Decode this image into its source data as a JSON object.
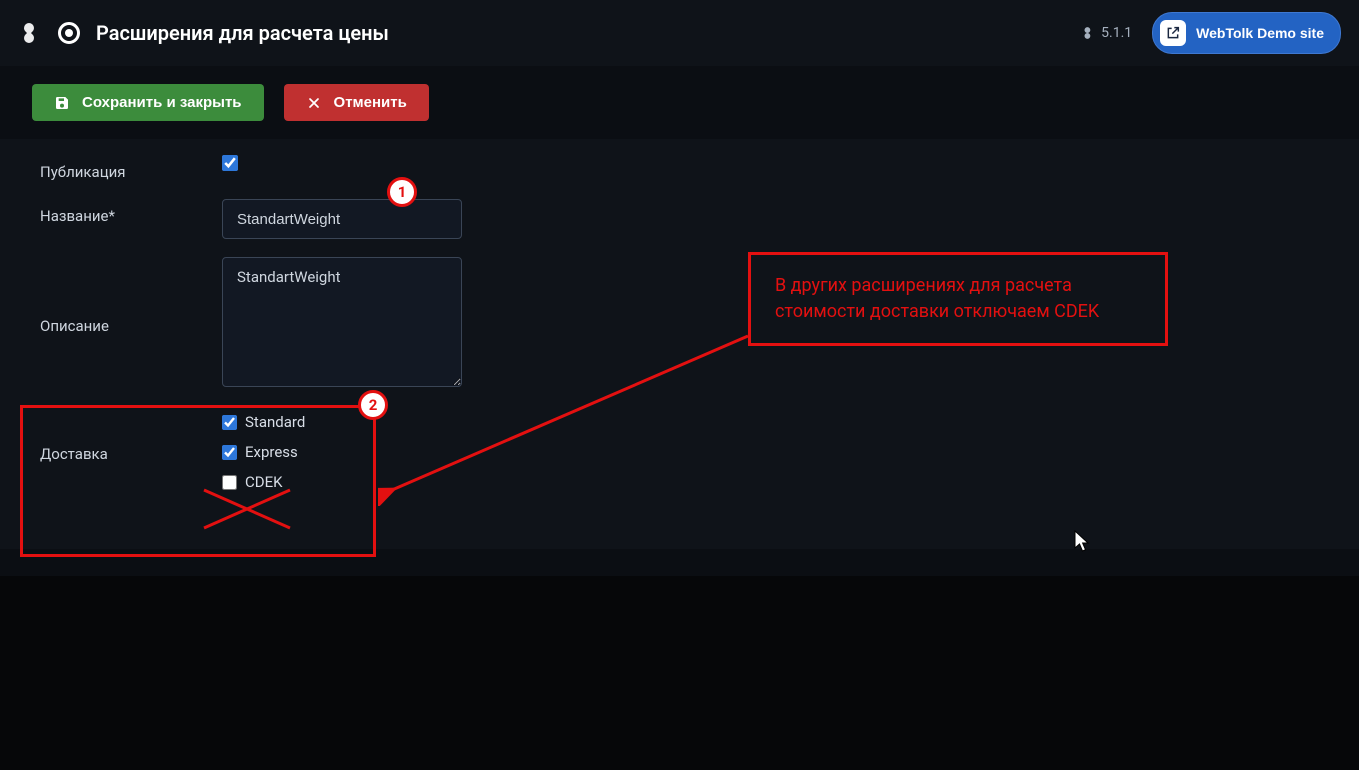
{
  "header": {
    "title": "Расширения для расчета цены",
    "version_label": "5.1.1",
    "demo_label": "WebTolk Demo site"
  },
  "toolbar": {
    "save_label": "Сохранить и закрыть",
    "cancel_label": "Отменить"
  },
  "form": {
    "publish_label": "Публикация",
    "publish_checked": true,
    "name_label": "Название*",
    "name_value": "StandartWeight",
    "desc_label": "Описание",
    "desc_value": "StandartWeight",
    "delivery_label": "Доставка",
    "delivery_options": [
      {
        "label": "Standard",
        "checked": true
      },
      {
        "label": "Express",
        "checked": true
      },
      {
        "label": "CDEK",
        "checked": false
      }
    ]
  },
  "annotations": {
    "badge1": "1",
    "badge2": "2",
    "callout_text": "В других расширениях для расчета стоимости доставки отключаем CDEK"
  }
}
